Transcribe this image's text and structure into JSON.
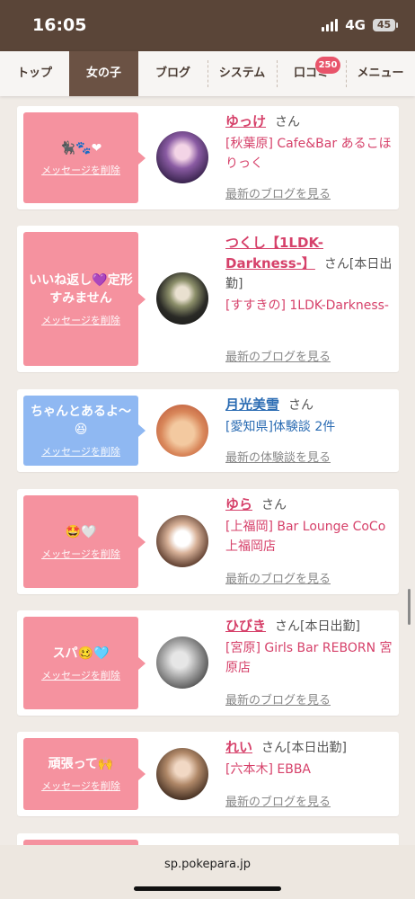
{
  "status": {
    "time": "16:05",
    "network": "4G",
    "battery": "45"
  },
  "nav": {
    "items": [
      {
        "label": "トップ"
      },
      {
        "label": "女の子"
      },
      {
        "label": "ブログ"
      },
      {
        "label": "システム"
      },
      {
        "label": "口コミ",
        "badge": "250"
      },
      {
        "label": "メニュー"
      }
    ],
    "active_index": 1
  },
  "cards": [
    {
      "message": "🐈‍⬛🐾❤",
      "delete_label": "メッセージを削除",
      "name": "ゆっけ",
      "honorific": "さん",
      "tag": "",
      "shop": "[秋葉原] Cafe&Bar あるこほりっく",
      "link": "最新のブログを見る",
      "bubble_color": "pink"
    },
    {
      "message": "いいね返し💜定形すみません",
      "delete_label": "メッセージを削除",
      "name": "つくし【1LDK-Darkness-】",
      "honorific": "さん",
      "tag": "[本日出勤]",
      "shop": "[すすきの] 1LDK-Darkness-",
      "link": "最新のブログを見る",
      "bubble_color": "pink"
    },
    {
      "message": "ちゃんとあるよ〜😆",
      "delete_label": "メッセージを削除",
      "name": "月光美雪",
      "honorific": "さん",
      "tag": "",
      "shop": "[愛知県]体験談 2件",
      "link": "最新の体験談を見る",
      "bubble_color": "blue"
    },
    {
      "message": "🤩🤍",
      "delete_label": "メッセージを削除",
      "name": "ゆら",
      "honorific": "さん",
      "tag": "",
      "shop": "[上福岡] Bar Lounge CoCo 上福岡店",
      "link": "最新のブログを見る",
      "bubble_color": "pink"
    },
    {
      "message": "スパ🥴🩵",
      "delete_label": "メッセージを削除",
      "name": "ひびき",
      "honorific": "さん",
      "tag": "[本日出勤]",
      "shop": "[宮原] Girls Bar REBORN 宮原店",
      "link": "最新のブログを見る",
      "bubble_color": "pink"
    },
    {
      "message": "頑張って🙌",
      "delete_label": "メッセージを削除",
      "name": "れい",
      "honorific": "さん",
      "tag": "[本日出勤]",
      "shop": "[六本木] EBBA",
      "link": "最新のブログを見る",
      "bubble_color": "pink"
    }
  ],
  "browser": {
    "url": "sp.pokepara.jp"
  }
}
